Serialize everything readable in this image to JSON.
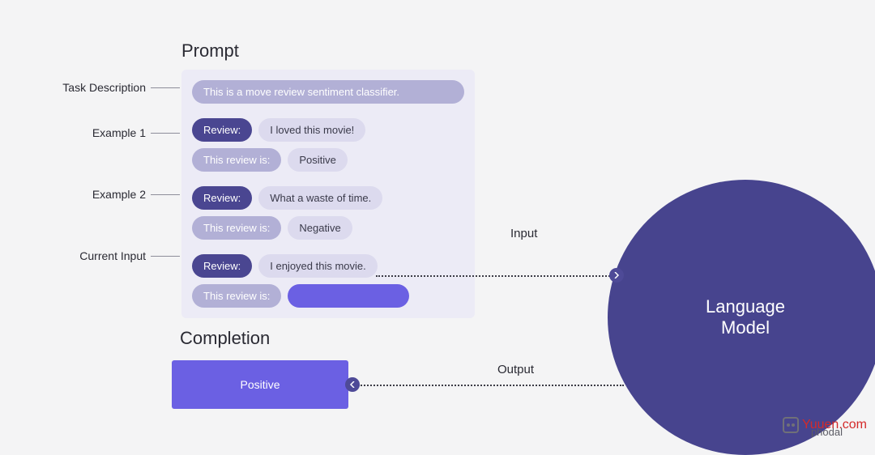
{
  "headings": {
    "prompt": "Prompt",
    "completion": "Completion"
  },
  "labels": {
    "task": "Task Description",
    "ex1": "Example 1",
    "ex2": "Example 2",
    "current": "Current Input",
    "input": "Input",
    "output": "Output"
  },
  "prompt": {
    "task": "This is a move review sentiment classifier.",
    "review_label": "Review:",
    "sentiment_label": "This review is:",
    "ex1": {
      "review": "I loved this movie!",
      "sentiment": "Positive"
    },
    "ex2": {
      "review": "What a waste of time.",
      "sentiment": "Negative"
    },
    "current": {
      "review": "I enjoyed this movie.",
      "sentiment": ""
    }
  },
  "completion": "Positive",
  "model": {
    "line1": "Language",
    "line2": "Model"
  },
  "watermark": {
    "site": "Yuuen.com",
    "handle": "phodal"
  }
}
